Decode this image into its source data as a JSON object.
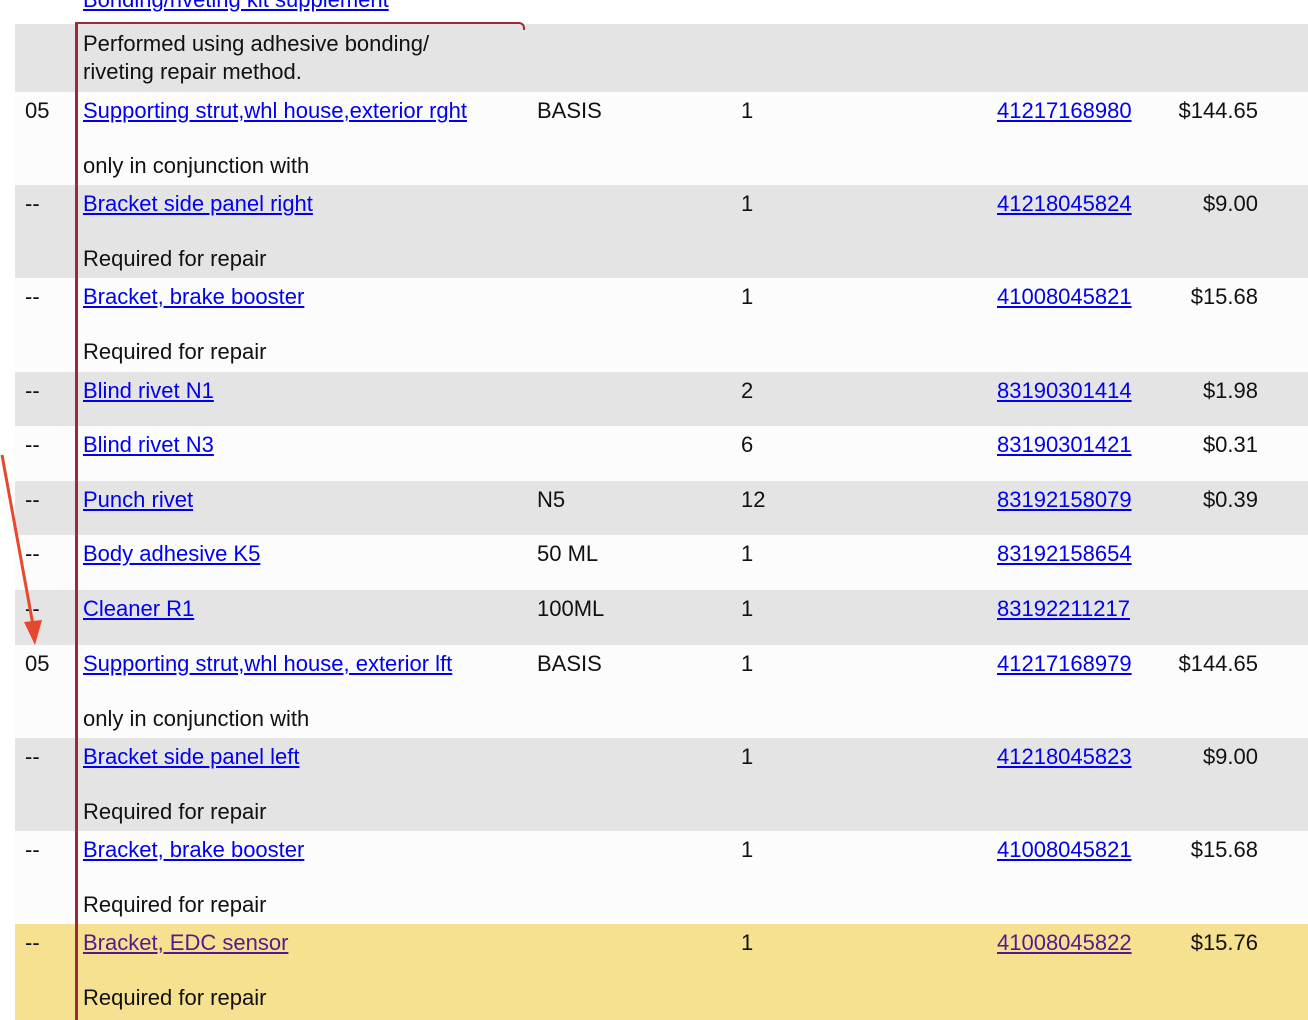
{
  "top_partial_link": "Bonding/riveting kit supplement",
  "header_note": "Performed using adhesive bonding/ riveting repair method.",
  "rows": [
    {
      "pos": "05",
      "desc": "Supporting strut,whl house,exterior rght",
      "spec": "BASIS",
      "qty": "1",
      "part_no": "41217168980",
      "price": "$144.65",
      "note": "only in conjunction with"
    },
    {
      "pos": "--",
      "desc": "Bracket side panel right",
      "spec": "",
      "qty": "1",
      "part_no": "41218045824",
      "price": "$9.00",
      "note": "Required for repair"
    },
    {
      "pos": "--",
      "desc": "Bracket, brake booster",
      "spec": "",
      "qty": "1",
      "part_no": "41008045821",
      "price": "$15.68",
      "note": "Required for repair"
    },
    {
      "pos": "--",
      "desc": "Blind rivet N1",
      "spec": "",
      "qty": "2",
      "part_no": "83190301414",
      "price": "$1.98",
      "note": ""
    },
    {
      "pos": "--",
      "desc": "Blind rivet N3",
      "spec": "",
      "qty": "6",
      "part_no": "83190301421",
      "price": "$0.31",
      "note": ""
    },
    {
      "pos": "--",
      "desc": "Punch rivet",
      "spec": "N5",
      "qty": "12",
      "part_no": "83192158079",
      "price": "$0.39",
      "note": ""
    },
    {
      "pos": "--",
      "desc": "Body adhesive K5",
      "spec": "50 ML",
      "qty": "1",
      "part_no": "83192158654",
      "price": "",
      "note": ""
    },
    {
      "pos": "--",
      "desc": "Cleaner R1",
      "spec": "100ML",
      "qty": "1",
      "part_no": "83192211217",
      "price": "",
      "note": ""
    },
    {
      "pos": "05",
      "desc": "Supporting strut,whl house, exterior lft",
      "spec": "BASIS",
      "qty": "1",
      "part_no": "41217168979",
      "price": "$144.65",
      "note": "only in conjunction with"
    },
    {
      "pos": "--",
      "desc": "Bracket side panel left",
      "spec": "",
      "qty": "1",
      "part_no": "41218045823",
      "price": "$9.00",
      "note": "Required for repair"
    },
    {
      "pos": "--",
      "desc": "Bracket, brake booster",
      "spec": "",
      "qty": "1",
      "part_no": "41008045821",
      "price": "$15.68",
      "note": "Required for repair"
    },
    {
      "pos": "--",
      "desc": "Bracket, EDC sensor",
      "spec": "",
      "qty": "1",
      "part_no": "41008045822",
      "price": "$15.76",
      "note": "Required for repair",
      "highlighted": true,
      "visited": true
    }
  ],
  "colors": {
    "row_grey": "#e4e4e4",
    "row_white": "#fcfcfc",
    "row_highlight": "#f6e190",
    "link": "#0000ee",
    "link_visited": "#551a8b",
    "frame_border": "#9b2c34",
    "annotation_arrow": "#e5482d"
  },
  "icons": {
    "annotation": "red-arrow-icon"
  }
}
